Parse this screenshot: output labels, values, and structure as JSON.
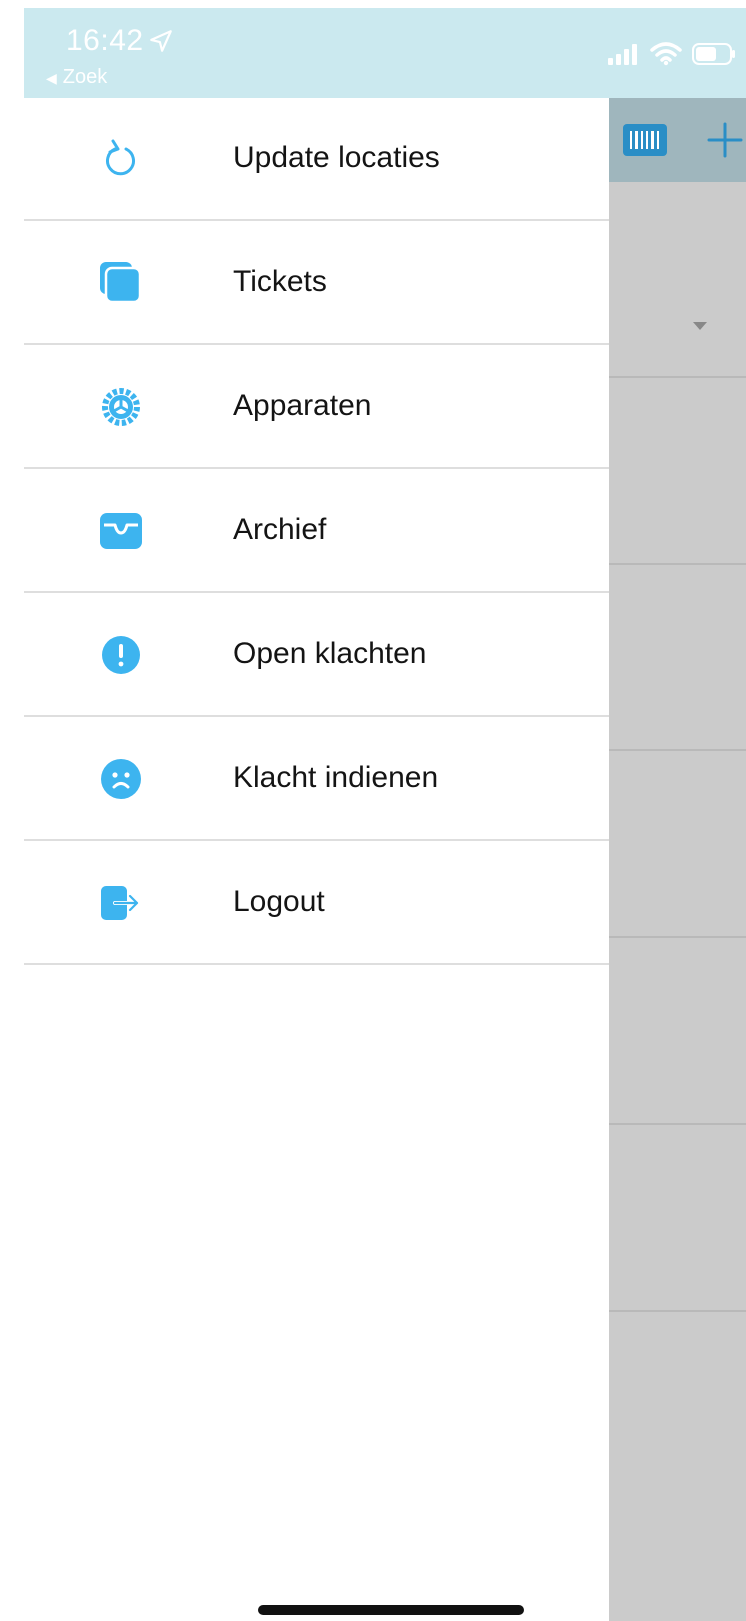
{
  "status_bar": {
    "time": "16:42",
    "back_label": "Zoek",
    "icons": [
      "location-arrow-icon",
      "signal-icon",
      "wifi-icon",
      "battery-icon"
    ]
  },
  "background_app": {
    "icons": [
      "barcode-icon",
      "plus-icon",
      "dropdown-arrow-icon"
    ],
    "colors": {
      "toolbar": "#9fb6bd",
      "content": "#cbcbcb"
    }
  },
  "menu": {
    "items": [
      {
        "label": "Update locaties",
        "icon": "refresh-icon"
      },
      {
        "label": "Tickets",
        "icon": "tickets-icon"
      },
      {
        "label": "Apparaten",
        "icon": "gear-icon"
      },
      {
        "label": "Archief",
        "icon": "archive-tray-icon"
      },
      {
        "label": "Open klachten",
        "icon": "exclamation-circle-icon"
      },
      {
        "label": "Klacht indienen",
        "icon": "sad-face-icon"
      },
      {
        "label": "Logout",
        "icon": "logout-icon"
      }
    ]
  },
  "colors": {
    "accent": "#3db4ef",
    "status_bar": "#cbe9ef",
    "divider": "#dedede"
  }
}
